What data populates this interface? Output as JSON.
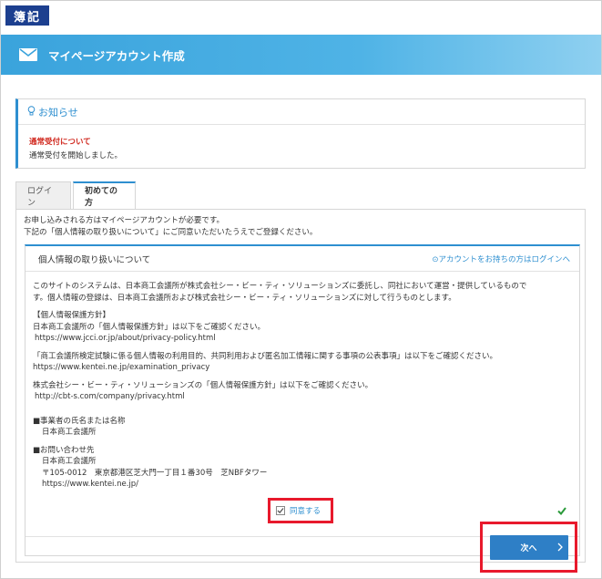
{
  "logo": {
    "text": "簿記"
  },
  "header": {
    "title": "マイページアカウント作成",
    "icon": "mail-icon"
  },
  "notice": {
    "heading": "お知らせ",
    "icon": "lightbulb-icon",
    "subject": "通常受付について",
    "message": "通常受付を開始しました。"
  },
  "tabs": [
    {
      "label": "ログイン",
      "active": false
    },
    {
      "label": "初めての方",
      "active": true
    }
  ],
  "intro": {
    "line1": "お申し込みされる方はマイページアカウントが必要です。",
    "line2": "下記の「個人情報の取り扱いについて」にご同意いただいたうえでご登録ください。"
  },
  "policy": {
    "title": "個人情報の取り扱いについて",
    "login_link": "アカウントをお持ちの方はログインへ",
    "para1_line1": "このサイトのシステムは、日本商工会議所が株式会社シー・ビー・ティ・ソリューションズに委託し、同社において運営・提供しているもので",
    "para1_line2": "す。個人情報の登録は、日本商工会議所および株式会社シー・ビー・ティ・ソリューションズに対して行うものとします。",
    "section1_heading": "【個人情報保護方針】",
    "section1_text": "日本商工会議所の「個人情報保護方針」は以下をご確認ください。",
    "section1_url": "https://www.jcci.or.jp/about/privacy-policy.html",
    "section2_text": "「商工会議所検定試験に係る個人情報の利用目的、共同利用および匿名加工情報に関する事項の公表事項」は以下をご確認ください。",
    "section2_url": "https://www.kentei.ne.jp/examination_privacy",
    "section3_text": "株式会社シー・ビー・ティ・ソリューションズの「個人情報保護方針」は以下をご確認ください。",
    "section3_url": "http://cbt-s.com/company/privacy.html",
    "operator_heading": "■事業者の氏名または名称",
    "operator_name": "日本商工会議所",
    "contact_heading": "■お問い合わせ先",
    "contact_name": "日本商工会議所",
    "contact_address": "〒105-0012　東京都港区芝大門一丁目１番30号　芝NBFタワー",
    "contact_url": "https://www.kentei.ne.jp/"
  },
  "agree": {
    "label": "同意する",
    "checked": true
  },
  "next_button": {
    "label": "次へ"
  },
  "colors": {
    "accent": "#2e8fd0",
    "highlight": "#e8192c",
    "notice_subject": "#d0271d",
    "valid": "#2a9a3a"
  }
}
